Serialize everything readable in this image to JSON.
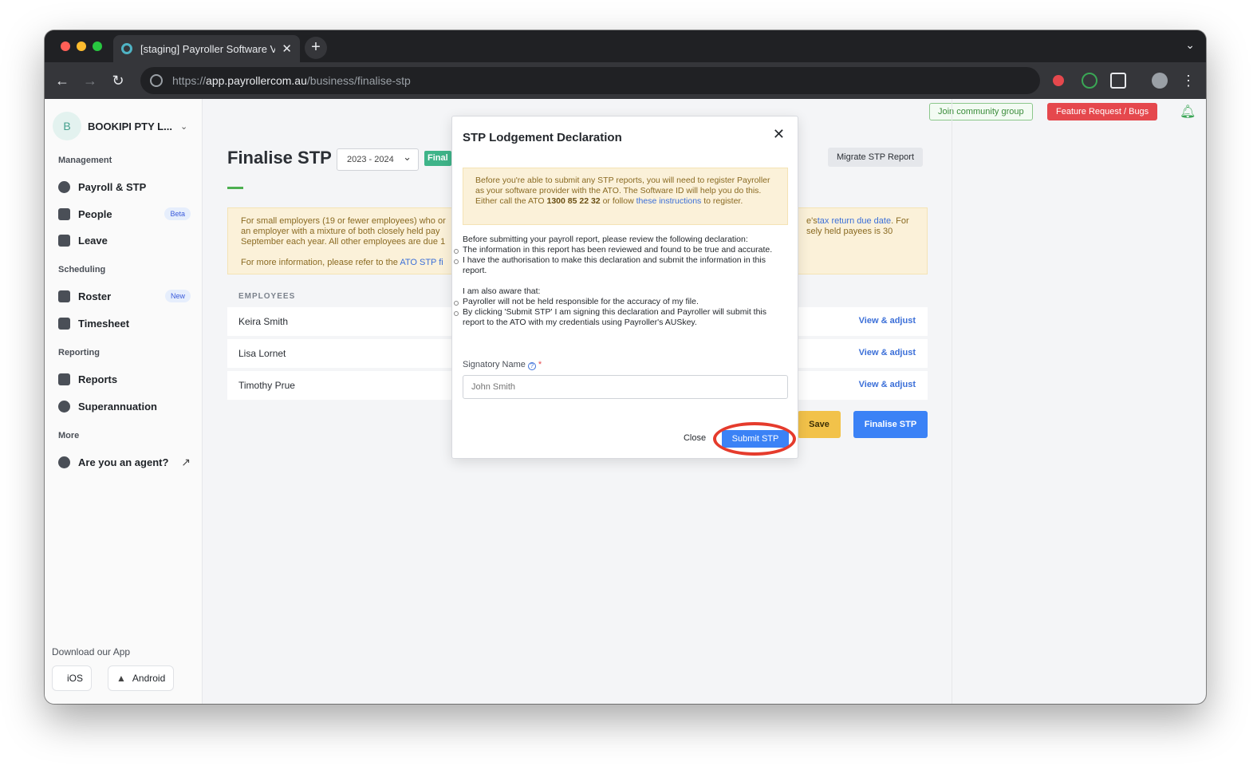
{
  "browser": {
    "tab_title": "[staging] Payroller Software V",
    "url_scheme": "https://",
    "url_host": "app.payrollercom.au",
    "url_path": "/business/finalise-stp"
  },
  "sidebar": {
    "avatar_letter": "B",
    "business_name": "BOOKIPI PTY L...",
    "sections": {
      "management": "Management",
      "scheduling": "Scheduling",
      "reporting": "Reporting",
      "more": "More"
    },
    "items": {
      "payroll": "Payroll & STP",
      "people": "People",
      "people_badge": "Beta",
      "leave": "Leave",
      "roster": "Roster",
      "roster_badge": "New",
      "timesheet": "Timesheet",
      "reports": "Reports",
      "superannuation": "Superannuation",
      "agent": "Are you an agent?"
    },
    "download_label": "Download our App",
    "ios": "iOS",
    "android": "Android"
  },
  "topbar": {
    "join_community": "Join community group",
    "feature_request": "Feature Request / Bugs"
  },
  "main": {
    "title": "Finalise STP",
    "year": "2023 - 2024",
    "status_pill": "Final",
    "migrate_button": "Migrate STP Report",
    "notice_line1": "For small employers (19 or fewer employees) who or",
    "notice_line1_right": "e's",
    "notice_line1_link": "tax return due date",
    "notice_line1_end": ". For",
    "notice_line2": "an employer with a mixture of both closely held pay",
    "notice_line2_right": "sely held payees is 30",
    "notice_line3": "September each year. All other employees are due 1",
    "notice_line4": "For more information, please refer to the ",
    "notice_line4_link": "ATO STP fi",
    "employees_header": "EMPLOYEES",
    "employees": [
      {
        "name": "Keira Smith",
        "action": "View & adjust"
      },
      {
        "name": "Lisa Lornet",
        "action": "View & adjust"
      },
      {
        "name": "Timothy Prue",
        "action": "View & adjust"
      }
    ],
    "save_button": "Save",
    "finalise_button": "Finalise STP"
  },
  "modal": {
    "title": "STP Lodgement Declaration",
    "warn_text1": "Before you're able to submit any STP reports, you will need to register Payroller as your software provider with the ATO. The Software ID will help you do this. Either call the ATO ",
    "warn_phone": "1300 85 22 32",
    "warn_text2": " or follow ",
    "warn_link": "these instructions",
    "warn_text3": " to register.",
    "intro": "Before submitting your payroll report, please review the following declaration:",
    "decl_1": "The information in this report has been reviewed and found to be true and accurate.",
    "decl_2": "I have the authorisation to make this declaration and submit the information in this report.",
    "aware": "I am also aware that:",
    "aware_1": "Payroller will not be held responsible for the accuracy of my file.",
    "aware_2": "By clicking 'Submit STP' I am signing this declaration and Payroller will submit this report to the ATO with my credentials using Payroller's AUSkey.",
    "signatory_label": "Signatory Name",
    "signatory_placeholder": "John Smith",
    "close_button": "Close",
    "submit_button": "Submit STP"
  }
}
